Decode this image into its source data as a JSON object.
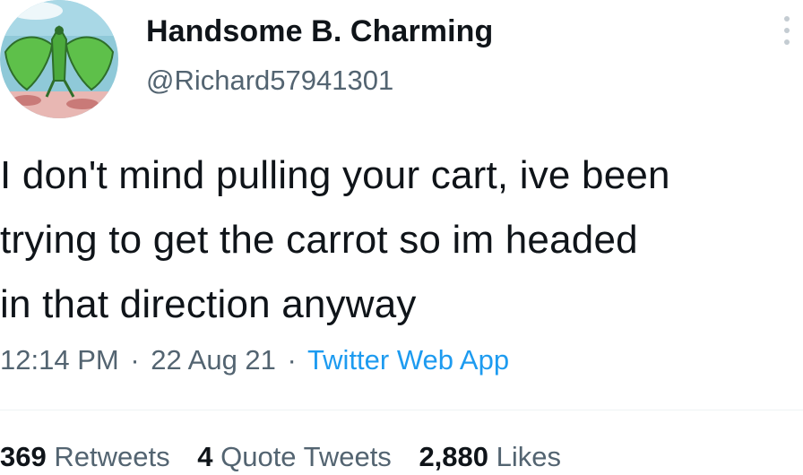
{
  "author": {
    "display_name": "Handsome B. Charming",
    "handle": "@Richard57941301",
    "avatar_icon": "cartoon-dragon-avatar"
  },
  "tweet": {
    "text_lines": [
      "I don't mind pulling your cart, ive been",
      "trying to get the carrot so im headed",
      "in that direction anyway"
    ],
    "time": "12:14 PM",
    "date": "22 Aug 21",
    "separator": "·",
    "source": "Twitter Web App"
  },
  "stats": {
    "retweets": {
      "count": "369",
      "label": "Retweets"
    },
    "quote_tweets": {
      "count": "4",
      "label": "Quote Tweets"
    },
    "likes": {
      "count": "2,880",
      "label": "Likes"
    }
  },
  "colors": {
    "text_primary": "#0f1419",
    "text_secondary": "#536471",
    "link": "#1d9bf0",
    "divider": "#eff3f4"
  }
}
